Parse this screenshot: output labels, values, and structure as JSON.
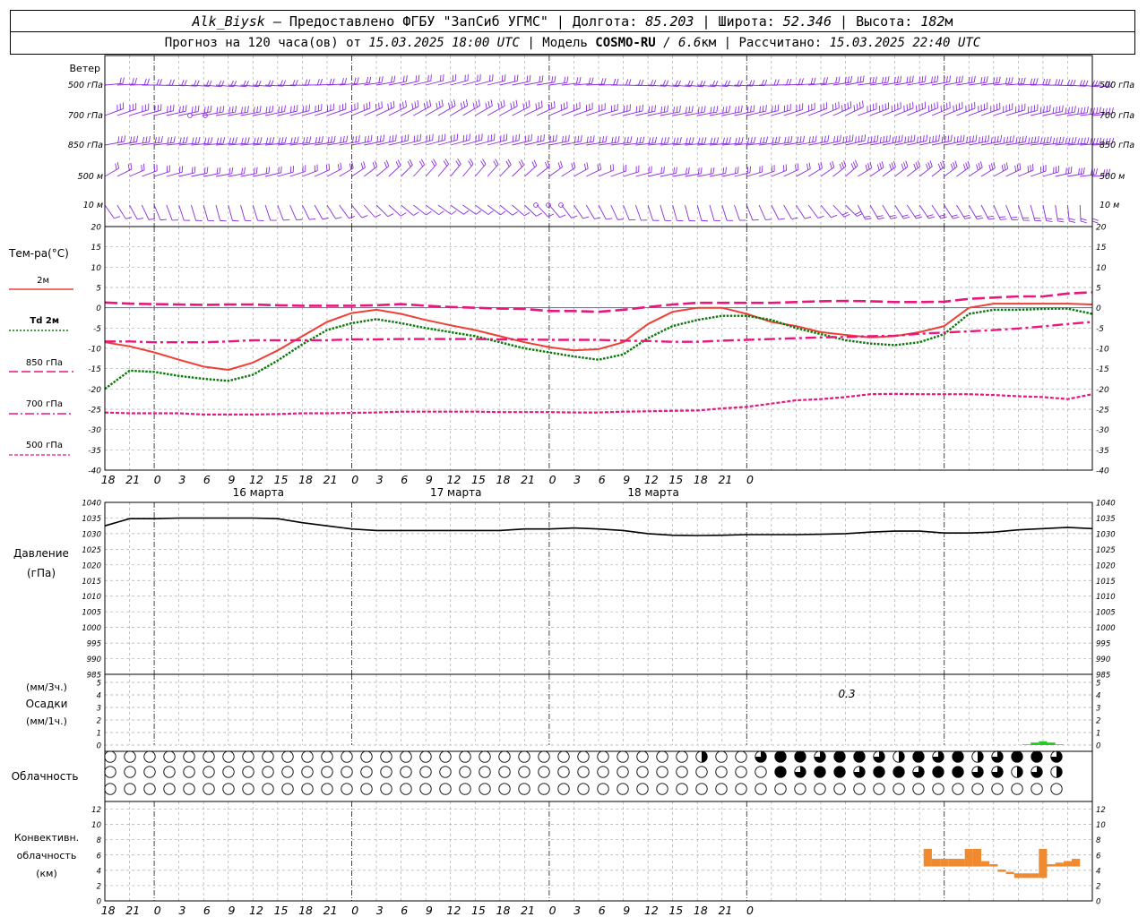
{
  "header": {
    "station": "Alk_Biysk",
    "dash": "—",
    "provider": "Предоставлено ФГБУ \"ЗапСиб УГМС\"",
    "lon_label": "Долгота:",
    "lon": "85.203",
    "lat_label": "Широта:",
    "lat": "52.346",
    "alt_label": "Высота:",
    "alt": "182",
    "alt_unit": "м",
    "forecast_label": "Прогноз на 120 часа(ов) от",
    "forecast_start": "15.03.2025 18:00 UTC",
    "model_label": "Модель",
    "model": "COSMO-RU",
    "resolution": "/ 6.6",
    "resolution_unit": "км",
    "computed_label": "Рассчитано:",
    "computed": "15.03.2025 22:40 UTC"
  },
  "colors": {
    "wind": "#8a2be2",
    "t2m": "#ee4036",
    "td2m": "#0a7a0a",
    "t850": "#e8177f",
    "t700": "#e8177f",
    "t500": "#e8177f",
    "pressure": "#000000",
    "precip": "#22cc22",
    "convective": "#f08a30",
    "zero_line": "#4169e1",
    "grid": "#aaaaaa"
  },
  "wind_panel": {
    "title": "Ветер",
    "levels": [
      "500 гПа",
      "700 гПа",
      "850 гПа",
      "500 м",
      "10 м"
    ]
  },
  "temperature_panel": {
    "title": "Тем-ра(°C)",
    "legend": [
      {
        "label": "2м",
        "style": "solid"
      },
      {
        "label": "Td  2м",
        "style": "dotted"
      },
      {
        "label": "850 гПа",
        "style": "longdash"
      },
      {
        "label": "700 гПа",
        "style": "dashdot"
      },
      {
        "label": "500 гПа",
        "style": "dashed"
      }
    ],
    "ticks": [
      "20",
      "15",
      "10",
      "5",
      "0",
      "-5",
      "-10",
      "-15",
      "-20",
      "-25",
      "-30",
      "-35",
      "-40"
    ]
  },
  "time_axis": {
    "hour_labels": [
      "18",
      "21",
      "0",
      "3",
      "6",
      "9",
      "12",
      "15",
      "18",
      "21",
      "0",
      "3",
      "6",
      "9",
      "12",
      "15",
      "18",
      "21",
      "0",
      "3",
      "6",
      "9",
      "12",
      "15",
      "18",
      "21",
      "0"
    ],
    "dates": [
      "16 марта",
      "17 марта",
      "18 марта"
    ]
  },
  "pressure_panel": {
    "title_line1": "Давление",
    "title_line2": "(гПа)",
    "ticks": [
      "1040",
      "1035",
      "1030",
      "1025",
      "1020",
      "1015",
      "1010",
      "1005",
      "1000",
      "995",
      "990",
      "985"
    ]
  },
  "precip_panel": {
    "label_top": "(мм/3ч.)",
    "label_mid": "Осадки",
    "label_bot": "(мм/1ч.)",
    "ticks": [
      "5",
      "4",
      "3",
      "2",
      "1",
      "0"
    ],
    "annotation": "0.3"
  },
  "cloud_panel": {
    "title": "Облачность"
  },
  "convective_panel": {
    "title_line1": "Конвективн.",
    "title_line2": "облачность",
    "title_line3": "(км)",
    "ticks": [
      "12",
      "10",
      "8",
      "6",
      "4",
      "2",
      "0"
    ]
  },
  "chart_data": [
    {
      "type": "line",
      "title": "Тем-ра(°C)",
      "x_hours": [
        0,
        3,
        6,
        9,
        12,
        15,
        18,
        21,
        24,
        27,
        30,
        33,
        36,
        39,
        42,
        45,
        48,
        51,
        54,
        57,
        60,
        63,
        66,
        69,
        72,
        75,
        78,
        81,
        84,
        87,
        90,
        93,
        96,
        99,
        102,
        105,
        108,
        111,
        114,
        117,
        120
      ],
      "ylim": [
        -40,
        20
      ],
      "series": [
        {
          "name": "2м",
          "values": [
            -8.5,
            -9.5,
            -11,
            -12.8,
            -14.5,
            -15.3,
            -13.5,
            -10.5,
            -7,
            -3.5,
            -1.3,
            -0.5,
            -1.5,
            -3,
            -4.3,
            -5.5,
            -7,
            -8.5,
            -9.7,
            -10.5,
            -10.2,
            -8.5,
            -4,
            -1,
            0,
            0,
            -1.5,
            -3.5,
            -4.5,
            -6,
            -6.7,
            -7.3,
            -7,
            -6,
            -4.5,
            0,
            1,
            1,
            1,
            1,
            0.8
          ]
        },
        {
          "name": "Td  2м",
          "values": [
            -20,
            -15.5,
            -15.8,
            -16.8,
            -17.5,
            -18,
            -16.5,
            -13,
            -9,
            -5.5,
            -3.8,
            -2.8,
            -3.8,
            -5,
            -6,
            -7,
            -8.5,
            -10,
            -11,
            -12,
            -12.8,
            -11.5,
            -7.5,
            -4.5,
            -3,
            -2,
            -2,
            -3,
            -5,
            -6.5,
            -8,
            -8.8,
            -9.2,
            -8.5,
            -6.5,
            -1.5,
            -0.5,
            -0.5,
            -0.3,
            -0.2,
            -1.5
          ]
        },
        {
          "name": "850 гПа",
          "values": [
            1.3,
            1,
            0.9,
            0.8,
            0.7,
            0.8,
            0.8,
            0.6,
            0.5,
            0.5,
            0.5,
            0.6,
            0.9,
            0.5,
            0.2,
            0,
            -0.2,
            -0.3,
            -0.8,
            -0.8,
            -1,
            -0.5,
            0.2,
            0.8,
            1.2,
            1.2,
            1.2,
            1.2,
            1.4,
            1.6,
            1.7,
            1.6,
            1.4,
            1.4,
            1.5,
            2.2,
            2.5,
            2.8,
            2.8,
            3.5,
            3.8
          ]
        },
        {
          "name": "700 гПа",
          "values": [
            -8.3,
            -8.3,
            -8.5,
            -8.5,
            -8.5,
            -8.3,
            -8,
            -8,
            -8,
            -8,
            -7.8,
            -7.8,
            -7.7,
            -7.7,
            -7.7,
            -7.7,
            -7.8,
            -7.8,
            -7.9,
            -7.9,
            -7.9,
            -8.1,
            -8.2,
            -8.4,
            -8.4,
            -8.1,
            -7.9,
            -7.7,
            -7.5,
            -7.3,
            -7.2,
            -7,
            -6.9,
            -6.4,
            -6.1,
            -5.8,
            -5.5,
            -5.1,
            -4.6,
            -4,
            -3.5
          ]
        },
        {
          "name": "500 гПа",
          "values": [
            -25.8,
            -26,
            -26,
            -26,
            -26.3,
            -26.3,
            -26.3,
            -26.2,
            -26,
            -26,
            -25.9,
            -25.8,
            -25.6,
            -25.6,
            -25.6,
            -25.6,
            -25.7,
            -25.7,
            -25.7,
            -25.8,
            -25.8,
            -25.6,
            -25.5,
            -25.4,
            -25.3,
            -24.8,
            -24.4,
            -23.6,
            -22.8,
            -22.5,
            -22,
            -21.3,
            -21.2,
            -21.3,
            -21.3,
            -21.3,
            -21.5,
            -21.8,
            -22,
            -22.5,
            -21.3
          ]
        }
      ]
    },
    {
      "type": "line",
      "title": "Давление",
      "x_hours": [
        0,
        3,
        6,
        9,
        12,
        15,
        18,
        21,
        24,
        27,
        30,
        33,
        36,
        39,
        42,
        45,
        48,
        51,
        54,
        57,
        60,
        63,
        66,
        69,
        72,
        75,
        78,
        81,
        84,
        87,
        90,
        93,
        96,
        99,
        102,
        105,
        108,
        111,
        114,
        117,
        120
      ],
      "ylim": [
        985,
        1040
      ],
      "series": [
        {
          "name": "Давление",
          "values": [
            1032.5,
            1034.8,
            1034.8,
            1035,
            1035,
            1035,
            1035,
            1034.8,
            1033.5,
            1032.5,
            1031.5,
            1031,
            1031,
            1031,
            1031,
            1031,
            1031,
            1031.5,
            1031.5,
            1031.8,
            1031.5,
            1031,
            1030,
            1029.5,
            1029.4,
            1029.5,
            1029.7,
            1029.7,
            1029.7,
            1029.8,
            1030,
            1030.5,
            1030.8,
            1030.8,
            1030.2,
            1030.2,
            1030.5,
            1031.2,
            1031.6,
            1032,
            1031.6
          ]
        }
      ]
    },
    {
      "type": "bar",
      "title": "Осадки",
      "x_hours": [
        90,
        91,
        92,
        93,
        94,
        95,
        96,
        97,
        98,
        99,
        100,
        101,
        102,
        103,
        104,
        105,
        106,
        107,
        108,
        109,
        110,
        111,
        112,
        113,
        114,
        115,
        116,
        117,
        118,
        119,
        120
      ],
      "ylim": [
        0,
        5
      ],
      "series": [
        {
          "name": "мм/1ч",
          "values": [
            0,
            0,
            0,
            0,
            0,
            0,
            0,
            0,
            0,
            0,
            0,
            0,
            0,
            0,
            0,
            0,
            0,
            0,
            0,
            0,
            0,
            0,
            0.05,
            0.2,
            0.3,
            0.2,
            0.05,
            0,
            0,
            0,
            0
          ]
        }
      ]
    },
    {
      "type": "bar",
      "title": "Конвективн. облачность",
      "x_hours": [
        100,
        101,
        102,
        103,
        104,
        105,
        106,
        107,
        108,
        109,
        110,
        111,
        112,
        113,
        114,
        115,
        116,
        117,
        118
      ],
      "ylim": [
        0,
        13
      ],
      "series": [
        {
          "name": "нижняя граница (км)",
          "values": [
            4.5,
            4.5,
            4.5,
            4.5,
            4.5,
            4.5,
            4.5,
            4.5,
            4.5,
            3.8,
            3.5,
            3,
            3,
            3,
            3,
            4.5,
            4.5,
            4.5,
            4.5
          ]
        },
        {
          "name": "верхняя граница (км)",
          "values": [
            6.8,
            5.5,
            5.5,
            5.5,
            5.5,
            6.8,
            6.8,
            5.2,
            4.5,
            4,
            3.5,
            3.6,
            3.6,
            3.6,
            6.8,
            4.8,
            5.0,
            5.2,
            5.5
          ]
        }
      ]
    }
  ]
}
